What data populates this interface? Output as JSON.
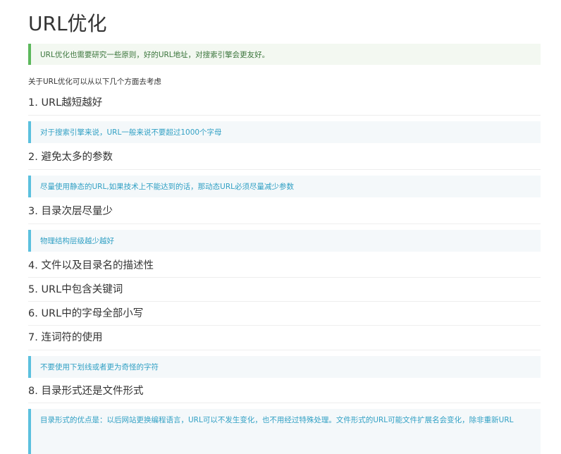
{
  "title": "URL优化",
  "callout": "URL优化也需要研究一些原则，好的URL地址，对搜索引擎会更友好。",
  "intro": "关于URL优化可以从以下几个方面去考虑",
  "sections": [
    {
      "heading": "1. URL越短越好",
      "note": "对于搜索引擎来说，URL一般来说不要超过1000个字母"
    },
    {
      "heading": "2. 避免太多的参数",
      "note": "尽量使用静态的URL,如果技术上不能达到的话，那动态URL必须尽量减少参数"
    },
    {
      "heading": "3. 目录次层尽量少",
      "note": "物理结构层级越少越好"
    },
    {
      "heading": "4. 文件以及目录名的描述性"
    },
    {
      "heading": "5. URL中包含关键词"
    },
    {
      "heading": "6. URL中的字母全部小写"
    },
    {
      "heading": "7. 连词符的使用",
      "note": "不要使用下划线或者更为奇怪的字符"
    },
    {
      "heading": "8. 目录形式还是文件形式",
      "note": "目录形式的优点是：以后网站更换编程语言，URL可以不发生变化，也不用经过特殊处理。文件形式的URL可能文件扩展名会变化，除非重新URL"
    }
  ],
  "colors": {
    "success_border": "#5cb85c",
    "success_text": "#3c763d",
    "info_border": "#5bc0de",
    "info_text": "#31a0c4"
  }
}
